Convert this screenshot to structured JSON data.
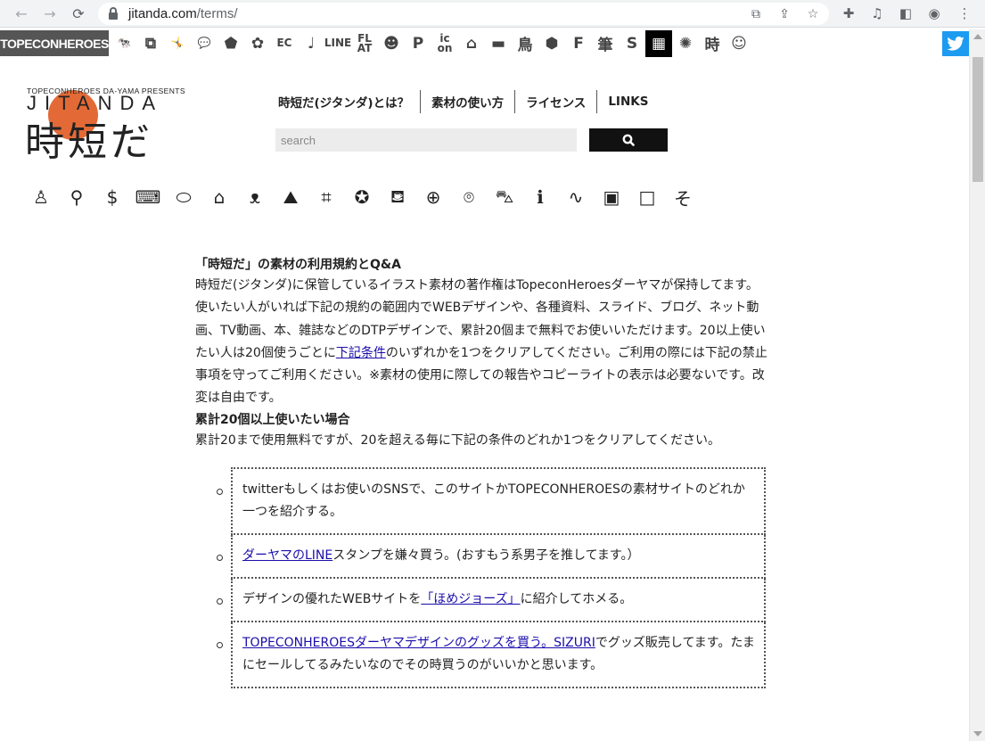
{
  "browser": {
    "url_host": "jitanda.com",
    "url_path": "/terms/",
    "icons": [
      "back-icon",
      "forward-icon",
      "reload-icon",
      "lock-icon",
      "translate-icon",
      "share-icon",
      "star-icon",
      "extensions-icon",
      "media-icon",
      "sidepanel-icon",
      "profile-icon",
      "menu-icon"
    ]
  },
  "sitebar": {
    "brand": "TOPECONHEROES",
    "icons": [
      "🐄",
      "⧉",
      "🤸",
      "💬",
      "⬟",
      "✿",
      "EC",
      "♩",
      "LINE",
      "FL\nAT",
      "☻",
      "P",
      "ic\non",
      "⌂",
      "▬",
      "鳥",
      "⬢",
      "F",
      "筆",
      "S",
      "▦",
      "✺",
      "時",
      "☺"
    ],
    "twitter_icon": "twitter-icon"
  },
  "header": {
    "logo_sub": "TOPECONHEROES DA-YAMA PRESENTS",
    "logo_latin": "JITANDA",
    "logo_jp": "時短だ",
    "nav": [
      "時短だ(ジタンダ)とは？",
      "素材の使い方",
      "ライセンス",
      "LINKS"
    ],
    "search_placeholder": "search"
  },
  "categories": [
    "person-icon",
    "tie-icon",
    "dollar-icon",
    "laptop-icon",
    "pill-icon",
    "house-icon",
    "cat-icon",
    "image-icon",
    "building-icon",
    "medal-icon",
    "sofa-icon",
    "basketball-icon",
    "pin-icon",
    "car-icon",
    "info-icon",
    "route-icon",
    "frame-icon",
    "square-icon",
    "other-icon"
  ],
  "category_glyphs": [
    "♙",
    "⚲",
    "$",
    "⌨",
    "⬭",
    "⌂",
    "ᴥ",
    "⛰",
    "⌗",
    "✪",
    "⛾",
    "⊕",
    "⌾",
    "⛍",
    "ℹ",
    "∿",
    "▣",
    "□",
    "そ"
  ],
  "content": {
    "title": "「時短だ」の素材の利用規約とQ&A",
    "para1_before": "時短だ(ジタンダ)に保管しているイラスト素材の著作権はTopeconHeroesダーヤマが保持してます。使いたい人がいれば下記の規約の範囲内でWEBデザインや、各種資料、スライド、ブログ、ネット動画、TV動画、本、雑誌などのDTPデザインで、累計20個まで無料でお使いいただけます。20以上使いたい人は20個使うごとに",
    "para1_link": "下記条件",
    "para1_after": "のいずれかを1つをクリアしてください。ご利用の際には下記の禁止事項を守ってご利用ください。※素材の使用に際しての報告やコピーライトの表示は必要ないです。改変は自由です。",
    "subtitle": "累計20個以上使いたい場合",
    "para2": "累計20まで使用無料ですが、20を超える毎に下記の条件のどれか1つをクリアしてください。"
  },
  "conditions": [
    {
      "link": "",
      "text": "twitterもしくはお使いのSNSで、このサイトかTOPECONHEROESの素材サイトのどれか一つを紹介する。"
    },
    {
      "link": "ダーヤマのLINE",
      "text": "スタンプを嫌々買う。(おすもう系男子を推してます。）"
    },
    {
      "pre": "デザインの優れたWEBサイトを",
      "link": "「ほめジョーズ」",
      "text": "に紹介してホメる。"
    },
    {
      "link": "TOPECONHEROESダーヤマデザインのグッズを買う。SIZURI",
      "text": "でグッズ販売してます。たまにセールしてるみたいなのでその時買うのがいいかと思います。"
    }
  ]
}
